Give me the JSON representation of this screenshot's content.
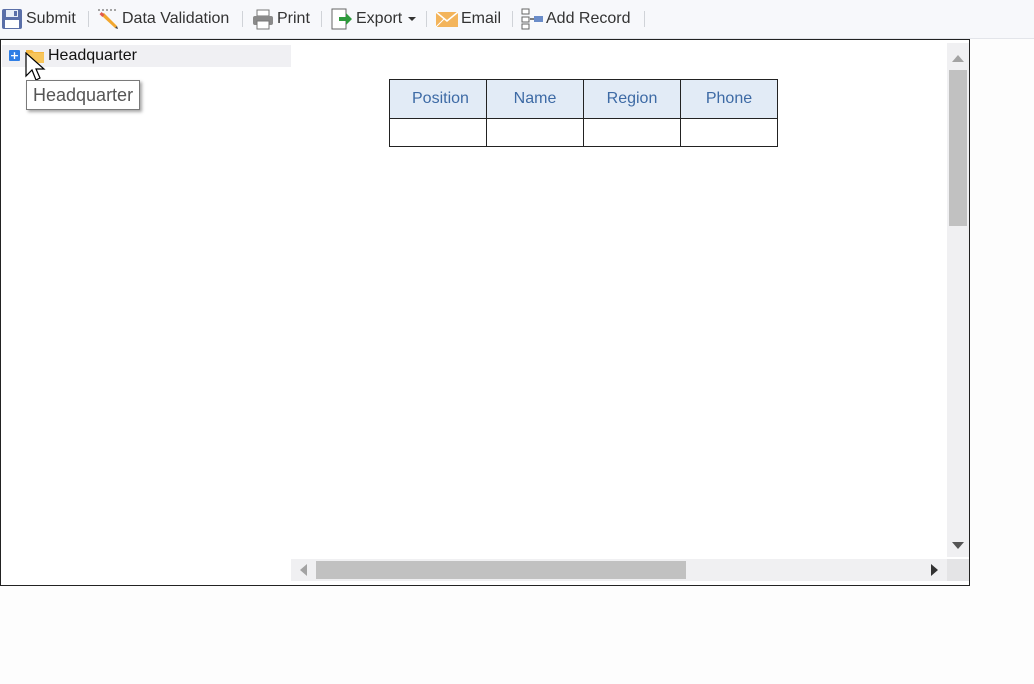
{
  "toolbar": {
    "submit": "Submit",
    "data_validation": "Data Validation",
    "print": "Print",
    "export": "Export",
    "email": "Email",
    "add_record": "Add Record"
  },
  "tree": {
    "root_label": "Headquarter",
    "expand_symbol": "+",
    "tooltip": "Headquarter"
  },
  "table": {
    "headers": [
      "Position",
      "Name",
      "Region",
      "Phone"
    ],
    "rows": [
      [
        "",
        "",
        "",
        ""
      ]
    ]
  },
  "colors": {
    "header_bg": "#e2ebf6",
    "header_text": "#3d6aa5",
    "expand_button": "#2f7ee5",
    "folder": "#f4b63f"
  }
}
